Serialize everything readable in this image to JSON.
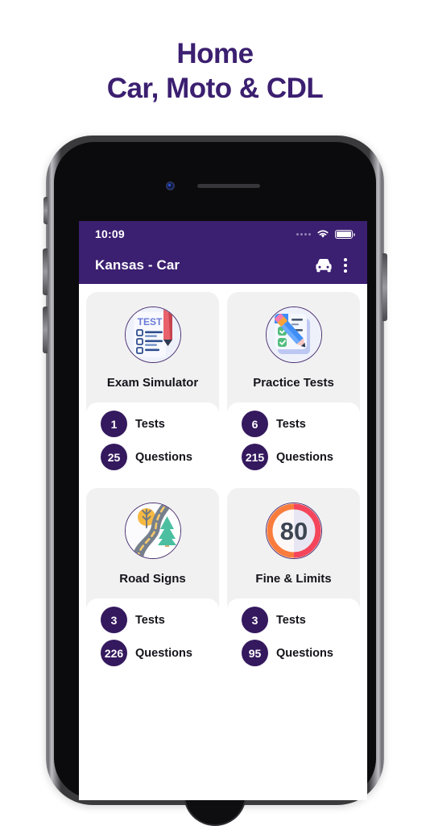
{
  "heading": {
    "line1": "Home",
    "line2": "Car, Moto & CDL",
    "color": "#3b1f70"
  },
  "phone": {
    "status_bar": {
      "time": "10:09",
      "wifi_icon": "wifi-icon",
      "battery_icon": "battery-full-icon",
      "signal_icon": "signal-dots-icon",
      "background": "#3b1f70"
    },
    "app_bar": {
      "title": "Kansas - Car",
      "vehicle_icon": "car-icon",
      "overflow_icon": "kebab-menu-icon",
      "background": "#3b1f70"
    }
  },
  "cards": [
    {
      "label": "Exam Simulator",
      "icon": "exam-clipboard-icon",
      "stats": [
        {
          "value": "1",
          "label": "Tests"
        },
        {
          "value": "25",
          "label": "Questions"
        }
      ]
    },
    {
      "label": "Practice Tests",
      "icon": "checklist-pencil-icon",
      "stats": [
        {
          "value": "6",
          "label": "Tests"
        },
        {
          "value": "215",
          "label": "Questions"
        }
      ]
    },
    {
      "label": "Road Signs",
      "icon": "winding-road-icon",
      "stats": [
        {
          "value": "3",
          "label": "Tests"
        },
        {
          "value": "226",
          "label": "Questions"
        }
      ]
    },
    {
      "label": "Fine & Limits",
      "icon": "speed-limit-80-icon",
      "stats": [
        {
          "value": "3",
          "label": "Tests"
        },
        {
          "value": "95",
          "label": "Questions"
        }
      ]
    }
  ],
  "theme": {
    "primary_purple": "#3b1f70",
    "badge_purple": "#34195e",
    "card_gray": "#f1f1f2"
  }
}
